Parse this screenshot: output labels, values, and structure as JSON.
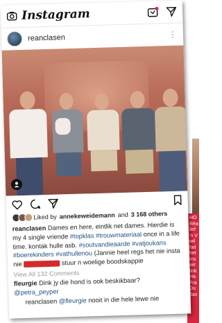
{
  "app": {
    "title": "Instagram"
  },
  "post": {
    "username": "reanclasen",
    "likes_prefix": "Liked by",
    "likes_user": "annekeweidemann",
    "likes_connector": "and",
    "likes_count": "3 168 others",
    "caption": {
      "user": "reanclasen",
      "text1": "Dames en here, eintlik net dames. Hierdie is my 4 single vriende",
      "tag1": "#topklas",
      "tag2": "#trouwmateriaal",
      "text2": "once in a life time. kontak hulle asb.",
      "tag3": "#soutvandieaarde",
      "tag4": "#vatjoukans",
      "tag5": "#boerekinders",
      "tag6": "#vathullenou",
      "text3": "(Jannie heel regs het nie insta nie",
      "text4": "stuur n woelige boodskappie"
    },
    "view_all": "View All 132 Comments",
    "comments": [
      {
        "user": "fleurgie",
        "text": "Dink jy die hond is ook beskikbaar?",
        "mention": "@petra_peyper"
      },
      {
        "user": "reanclasen",
        "mention": "@fleurgie",
        "text": "nooit in die hele lewe nie"
      }
    ]
  },
  "side_article": {
    "lines": [
      "HO",
      "Réa",
      "lief",
      "'n V",
      "wil",
      "hel",
      "het",
      "Ins",
      "wir",
      "link",
      "Ha",
      "Fra",
      "Du",
      "Jan"
    ]
  },
  "colors": {
    "photo_tint": "#b76a58",
    "hashtag": "#1f4f86",
    "redaction": "#d42a2a",
    "side_banner": "#d7263d"
  }
}
